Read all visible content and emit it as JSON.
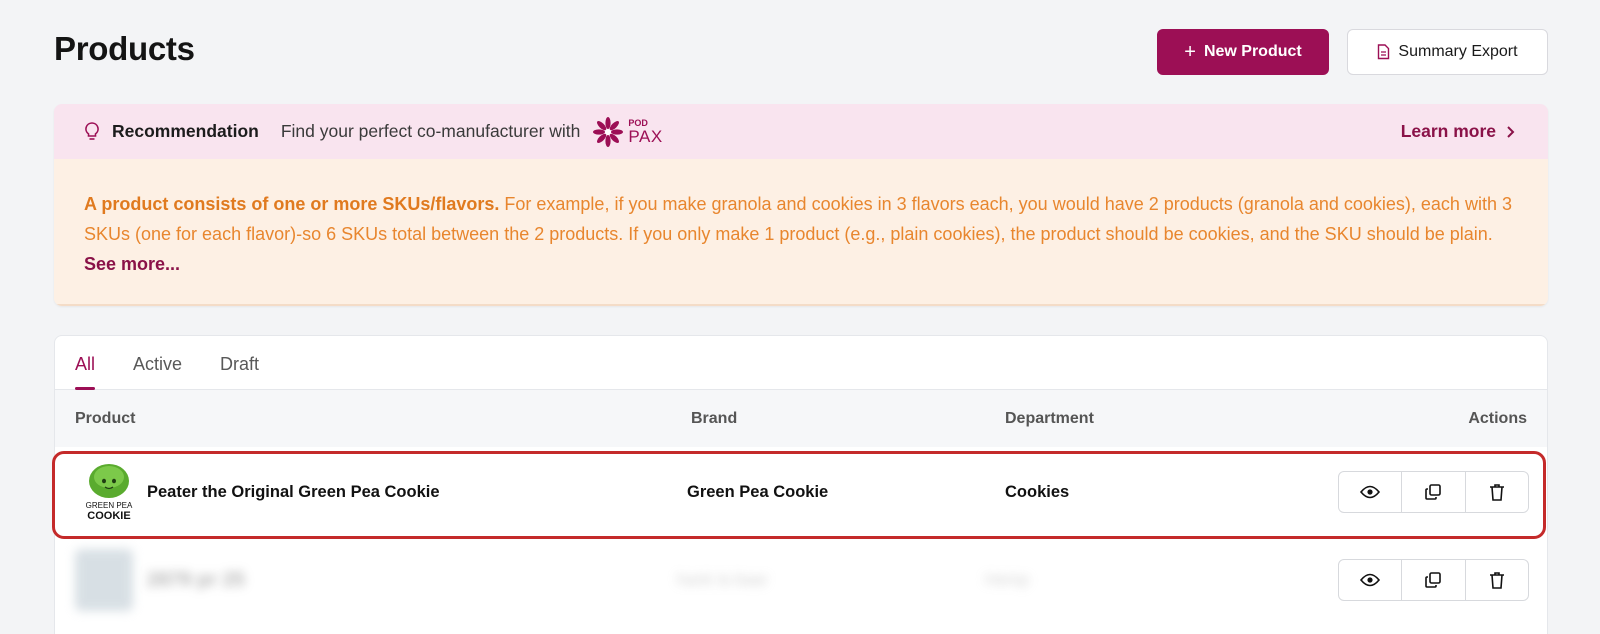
{
  "page": {
    "title": "Products"
  },
  "toolbar": {
    "new_product_label": "New Product",
    "summary_export_label": "Summary Export"
  },
  "recommendation": {
    "label": "Recommendation",
    "text": "Find your perfect co-manufacturer with",
    "brand_small": "POD",
    "brand_big": "PAX",
    "learn_more": "Learn more"
  },
  "note": {
    "bold": "A product consists of one or more SKUs/flavors.",
    "body": " For example, if you make granola and cookies in 3 flavors each, you would have 2 products (granola and cookies), each with 3 SKUs (one for each flavor)-so 6 SKUs total between the 2 products. If you only make 1 product (e.g., plain cookies), the product should be cookies, and the SKU should be plain. ",
    "see_more": "See more..."
  },
  "tabs": [
    {
      "label": "All",
      "active": true
    },
    {
      "label": "Active",
      "active": false
    },
    {
      "label": "Draft",
      "active": false
    }
  ],
  "table": {
    "headers": {
      "product": "Product",
      "brand": "Brand",
      "department": "Department",
      "actions": "Actions"
    },
    "rows": [
      {
        "logo_line1": "GREEN PEA",
        "logo_line2": "COOKIE",
        "product": "Peater the Original Green Pea Cookie",
        "brand": "Green Pea Cookie",
        "department": "Cookies"
      },
      {
        "product": "2879 pr 25",
        "brand": "hank la baar",
        "department": "Hemp"
      }
    ]
  },
  "colors": {
    "accent": "#9c0f55",
    "highlight": "#c42a2a",
    "note_text": "#e8862e",
    "reco_bg": "#f9e4ef",
    "note_bg": "#fdf0e4"
  },
  "icons": [
    "plus-icon",
    "document-icon",
    "lightbulb-icon",
    "podpax-flower-icon",
    "chevron-right-icon",
    "eye-icon",
    "duplicate-icon",
    "trash-icon"
  ]
}
